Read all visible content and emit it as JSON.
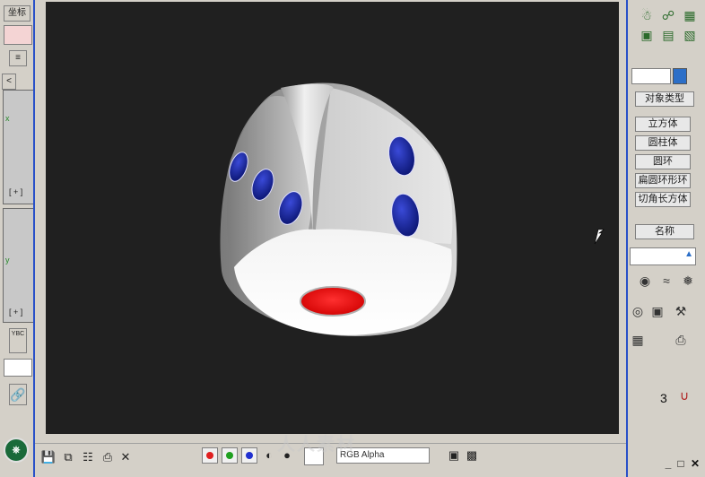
{
  "left_strip": {
    "top_label": "坐标",
    "scroll_left": "<",
    "viewport_label_1": "[ + ]",
    "viewport_label_2": "[ + ]",
    "axis_x": "x",
    "axis_y": "y",
    "tool_label": "YBC"
  },
  "render": {
    "background": "#202020",
    "toolbar": {
      "save_icon": "save-icon",
      "copy_icon": "copy-icon",
      "clone_icon": "clone-icon",
      "print_icon": "print-icon",
      "clear_label": "✕",
      "channels": [
        {
          "name": "red-channel",
          "color": "#e02020"
        },
        {
          "name": "green-channel",
          "color": "#20a020"
        },
        {
          "name": "blue-channel",
          "color": "#2030d0"
        }
      ],
      "channel_select_value": "RGB Alpha"
    },
    "watermark": "人人素材"
  },
  "right_panel": {
    "section_label": "对象类型",
    "buttons": [
      "立方体",
      "圆柱体",
      "圆环",
      "扁圆环形环",
      "切角长方体"
    ],
    "name_label": "名称",
    "number_label": "3",
    "accent_color": "#2c6fc8"
  },
  "window_controls": {
    "minimize": "_",
    "maximize": "□",
    "close": "✕"
  }
}
